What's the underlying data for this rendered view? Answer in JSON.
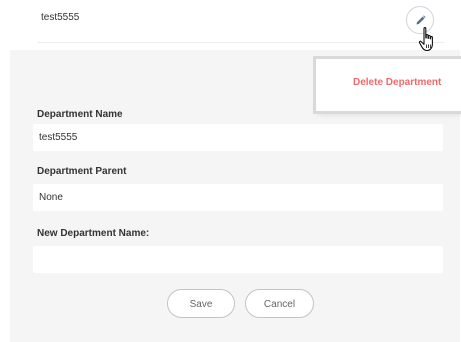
{
  "department_row": {
    "title": "test5555"
  },
  "icons": {
    "edit": "pencil-icon",
    "cursor": "hand-pointer-icon"
  },
  "dropdown": {
    "delete_label": "Delete Department"
  },
  "form": {
    "name_label": "Department Name",
    "name_value": "test5555",
    "parent_label": "Department Parent",
    "parent_value": "None",
    "new_name_label": "New Department Name:",
    "new_name_value": "",
    "save_label": "Save",
    "cancel_label": "Cancel"
  },
  "colors": {
    "delete_text": "#f06a6a",
    "panel_bg": "#f5f5f5",
    "border": "#bfc5cc"
  }
}
